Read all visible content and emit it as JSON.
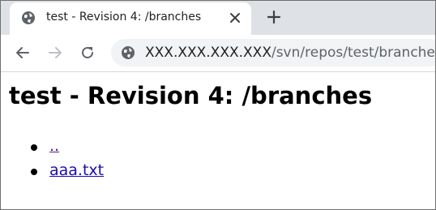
{
  "browser": {
    "tab": {
      "title": "test - Revision 4: /branches",
      "favicon": "globe-icon",
      "close_icon": "close-icon"
    },
    "new_tab_icon": "plus-icon",
    "toolbar": {
      "back_icon": "arrow-left-icon",
      "forward_icon": "arrow-right-icon",
      "reload_icon": "reload-icon",
      "address": {
        "security_icon": "globe-icon",
        "host": "XXX.XXX.XXX.XXX",
        "path": "/svn/repos/test/branches/"
      }
    }
  },
  "page": {
    "heading": "test - Revision 4: /branches",
    "entries": [
      {
        "label": "..",
        "visited": true
      },
      {
        "label": "aaa.txt",
        "visited": false
      }
    ]
  },
  "colors": {
    "tab_strip": "#dee1e6",
    "omnibox": "#f1f3f4",
    "link": "#1a0dab",
    "visited_link": "#551a8b"
  }
}
